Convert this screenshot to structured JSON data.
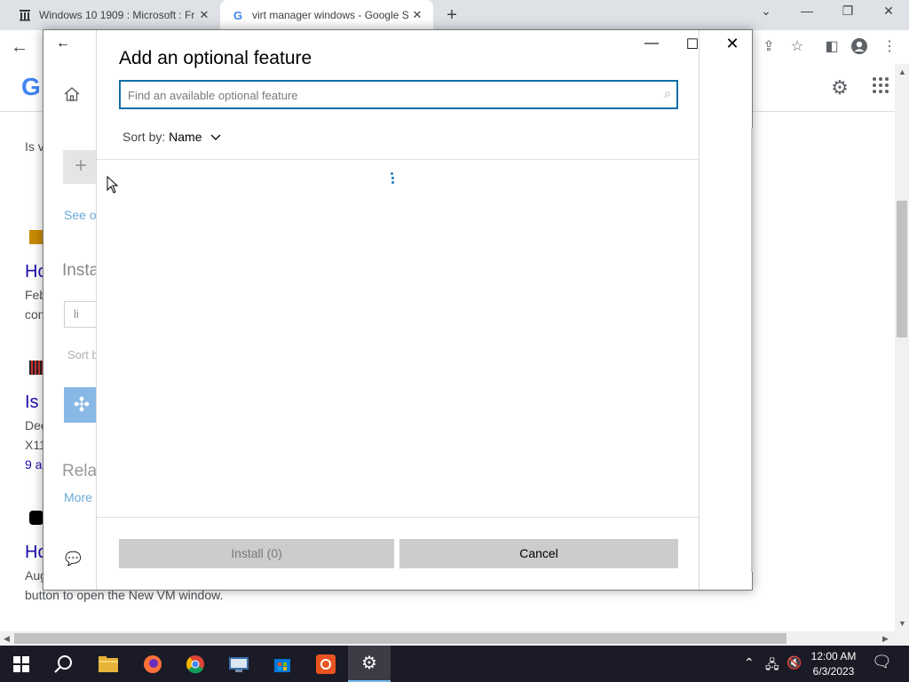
{
  "browser": {
    "tabs": [
      {
        "title": "Windows 10 1909 : Microsoft : Fr",
        "favicon": "archive-icon",
        "active": false
      },
      {
        "title": "virt manager windows - Google S",
        "favicon": "google-icon",
        "active": true
      }
    ],
    "new_tab": "+",
    "window_controls": [
      "⌄",
      "—",
      "❐",
      "✕"
    ]
  },
  "background_page": {
    "logo": "G",
    "fragments": {
      "is_v": "Is v",
      "see_op": "See op",
      "ho1": "Ho",
      "feb": "Feb",
      "con": "con",
      "insta": "Insta",
      "search_value": "li",
      "sort_frag": "Sort b",
      "is2": "Is",
      "dec": "Dec",
      "x11": "X11",
      "nine_a": "9 a",
      "rela": "Rela",
      "more": "More",
      "ho2": "Ho",
      "aug": "Aug",
      "bottom_line": "button to open the New VM window."
    }
  },
  "dialog": {
    "title": "Add an optional feature",
    "search_placeholder": "Find an available optional feature",
    "sort_label": "Sort by:",
    "sort_value": "Name",
    "install_button": "Install (0)",
    "cancel_button": "Cancel"
  },
  "taskbar": {
    "clock_time": "12:00 AM",
    "clock_date": "6/3/2023"
  },
  "colors": {
    "accent": "#0f6fa6",
    "taskbar": "#1a1b26",
    "button": "#cccccc"
  }
}
